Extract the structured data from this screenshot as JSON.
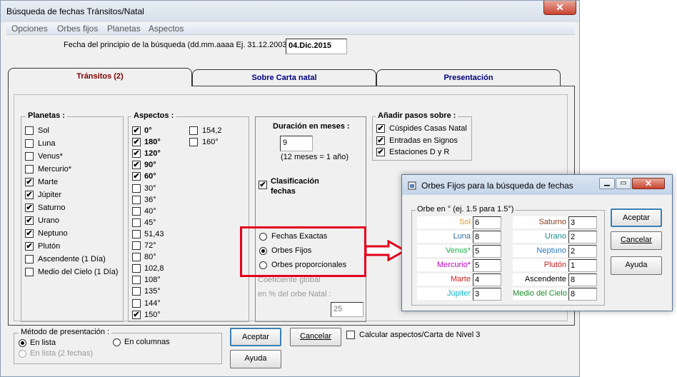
{
  "window": {
    "title": "Búsqueda de fechas Tránsitos/Natal",
    "close_glyph": "✕"
  },
  "menu": [
    "Opciones",
    "Orbes fijos",
    "Planetas",
    "Aspectos"
  ],
  "start_date": {
    "label": "Fecha del principio de la búsqueda (dd.mm.aaaa Ej. 31.12.2003) :",
    "value": "04.Dic.2015"
  },
  "tabs": [
    {
      "label": "Tránsitos (2)",
      "active": true
    },
    {
      "label": "Sobre Carta natal",
      "active": false
    },
    {
      "label": "Presentación",
      "active": false
    }
  ],
  "planetas": {
    "title": "Planetas :",
    "items": [
      {
        "label": "Sol",
        "checked": false
      },
      {
        "label": "Luna",
        "checked": false
      },
      {
        "label": "Venus*",
        "checked": false
      },
      {
        "label": "Mercurio*",
        "checked": false
      },
      {
        "label": "Marte",
        "checked": true
      },
      {
        "label": "Júpiter",
        "checked": true
      },
      {
        "label": "Saturno",
        "checked": true
      },
      {
        "label": "Urano",
        "checked": true
      },
      {
        "label": "Neptuno",
        "checked": true
      },
      {
        "label": "Plutón",
        "checked": true
      },
      {
        "label": "Ascendente (1 Día)",
        "checked": false
      },
      {
        "label": "Medio del Cielo (1 Día)",
        "checked": false
      }
    ]
  },
  "aspectos": {
    "title": "Aspectos :",
    "col1": [
      {
        "label": "0°",
        "checked": true,
        "bold": true
      },
      {
        "label": "180°",
        "checked": true,
        "bold": true
      },
      {
        "label": "120°",
        "checked": true,
        "bold": true
      },
      {
        "label": "90°",
        "checked": true,
        "bold": true
      },
      {
        "label": "60°",
        "checked": true,
        "bold": true
      },
      {
        "label": "30°",
        "checked": false,
        "bold": false
      },
      {
        "label": "36°",
        "checked": false,
        "bold": false
      },
      {
        "label": "40°",
        "checked": false,
        "bold": false
      },
      {
        "label": "45°",
        "checked": false,
        "bold": false
      },
      {
        "label": "51,43",
        "checked": false,
        "bold": false
      },
      {
        "label": "72°",
        "checked": false,
        "bold": false
      },
      {
        "label": "80°",
        "checked": false,
        "bold": false
      },
      {
        "label": "102,8",
        "checked": false,
        "bold": false
      },
      {
        "label": "108°",
        "checked": false,
        "bold": false
      },
      {
        "label": "135°",
        "checked": false,
        "bold": false
      },
      {
        "label": "144°",
        "checked": false,
        "bold": false
      },
      {
        "label": "150°",
        "checked": true,
        "bold": false
      }
    ],
    "col2": [
      {
        "label": "154,2",
        "checked": false
      },
      {
        "label": "160°",
        "checked": false
      }
    ]
  },
  "duracion": {
    "title": "Duración en meses :",
    "value": "9",
    "note": "(12 meses = 1 año)",
    "clasificacion_label": "Clasificación fechas",
    "clasificacion_checked": true,
    "radios": [
      {
        "label": "Fechas Exactas",
        "selected": false
      },
      {
        "label": "Orbes Fijos",
        "selected": true
      },
      {
        "label": "Orbes proporcionales",
        "selected": false
      }
    ],
    "coef_label1": "Coeficiente global",
    "coef_label2": "en % del orbe Natal :",
    "coef_value": "25"
  },
  "anadir": {
    "title": "Añadir pasos sobre :",
    "items": [
      {
        "label": "Cúspides Casas Natal",
        "checked": true
      },
      {
        "label": "Entradas en Signos",
        "checked": true
      },
      {
        "label": "Estaciones D y R",
        "checked": true
      }
    ]
  },
  "metodo": {
    "title": "Método de presentación :",
    "radios": [
      {
        "label": "En lista",
        "selected": true,
        "disabled": false
      },
      {
        "label": "En columnas",
        "selected": false,
        "disabled": false
      },
      {
        "label": "En lista (2 fechas)",
        "selected": false,
        "disabled": true
      }
    ]
  },
  "buttons": {
    "aceptar": "Aceptar",
    "cancelar": "Cancelar",
    "ayuda": "Ayuda",
    "nivel3_label": "Calcular aspectos/Carta de Nivel 3"
  },
  "dialog": {
    "title": "Orbes Fijos para la búsqueda de fechas",
    "group_title": "Orbe en ° (ej. 1.5 para 1.5°)",
    "left": [
      {
        "label": "Sol",
        "value": "6",
        "color": "#e89a2a"
      },
      {
        "label": "Luna",
        "value": "8",
        "color": "#2b6aa8"
      },
      {
        "label": "Venus*",
        "value": "5",
        "color": "#1fae4a"
      },
      {
        "label": "Mercurio*",
        "value": "5",
        "color": "#c000c0"
      },
      {
        "label": "Marte",
        "value": "4",
        "color": "#d02020"
      },
      {
        "label": "Júpiter",
        "value": "3",
        "color": "#18b0c8"
      }
    ],
    "right": [
      {
        "label": "Saturno",
        "value": "3",
        "color": "#8b3a1a"
      },
      {
        "label": "Urano",
        "value": "2",
        "color": "#1a8a8a"
      },
      {
        "label": "Neptuno",
        "value": "2",
        "color": "#2a7ab8"
      },
      {
        "label": "Plutón",
        "value": "1",
        "color": "#c02020"
      },
      {
        "label": "Ascendente",
        "value": "8",
        "color": "#000000"
      },
      {
        "label": "Medio del Cielo",
        "value": "8",
        "color": "#1a8a2a"
      }
    ],
    "aceptar": "Aceptar",
    "cancelar": "Cancelar",
    "ayuda": "Ayuda"
  },
  "accent_colors": {
    "red_highlight": "#e3001b",
    "tab_active": "#800000",
    "tab_inactive": "#000080"
  }
}
